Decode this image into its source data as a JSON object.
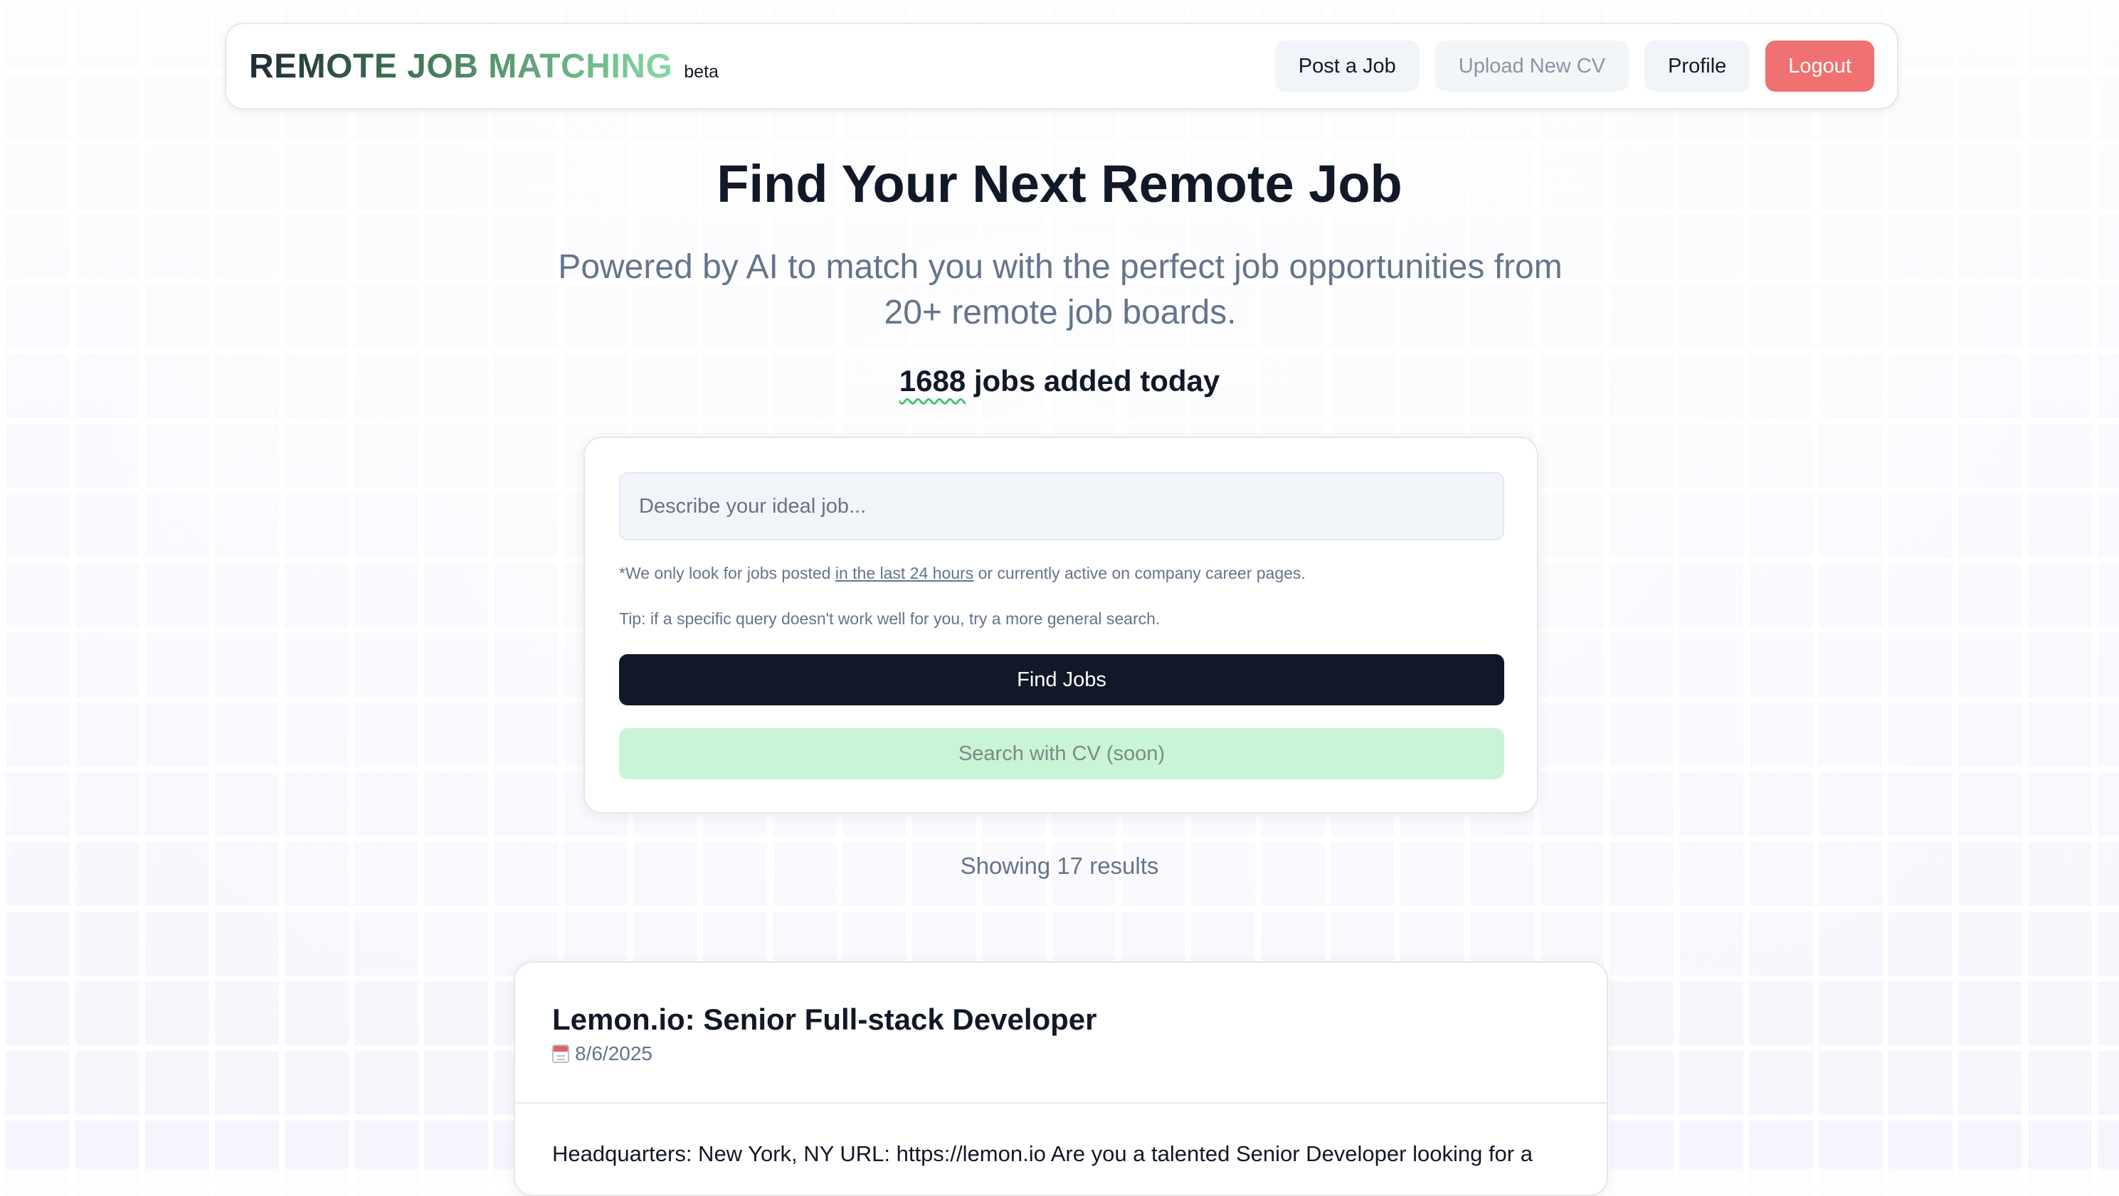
{
  "header": {
    "brand_title": "REMOTE JOB MATCHING",
    "brand_badge": "beta",
    "nav": {
      "post_job": "Post a Job",
      "upload_cv": "Upload New CV",
      "profile": "Profile",
      "logout": "Logout"
    }
  },
  "hero": {
    "title": "Find Your Next Remote Job",
    "subtitle": "Powered by AI to match you with the perfect job opportunities from 20+ remote job boards.",
    "jobs_count": "1688",
    "jobs_suffix": " jobs added today"
  },
  "search": {
    "placeholder": "Describe your ideal job...",
    "value": "",
    "note_prefix": "*We only look for jobs posted ",
    "note_link": "in the last 24 hours",
    "note_suffix": " or currently active on company career pages.",
    "tip": "Tip: if a specific query doesn't work well for you, try a more general search.",
    "find_button": "Find Jobs",
    "cv_button": "Search with CV (soon)"
  },
  "results": {
    "summary": "Showing 17 results"
  },
  "jobs": [
    {
      "title": "Lemon.io: Senior Full-stack Developer",
      "date_icon": "calendar-icon",
      "date": "8/6/2025",
      "description": "Headquarters: New York, NY URL: https://lemon.io Are you a talented Senior Developer looking for a"
    }
  ],
  "colors": {
    "accent_dark": "#111827",
    "logout": "#f07171",
    "cv_button_bg": "#c9f4d6",
    "brand_gradient_start": "#1f2937",
    "brand_gradient_end": "#86d9a4",
    "muted_text": "#64748b"
  }
}
